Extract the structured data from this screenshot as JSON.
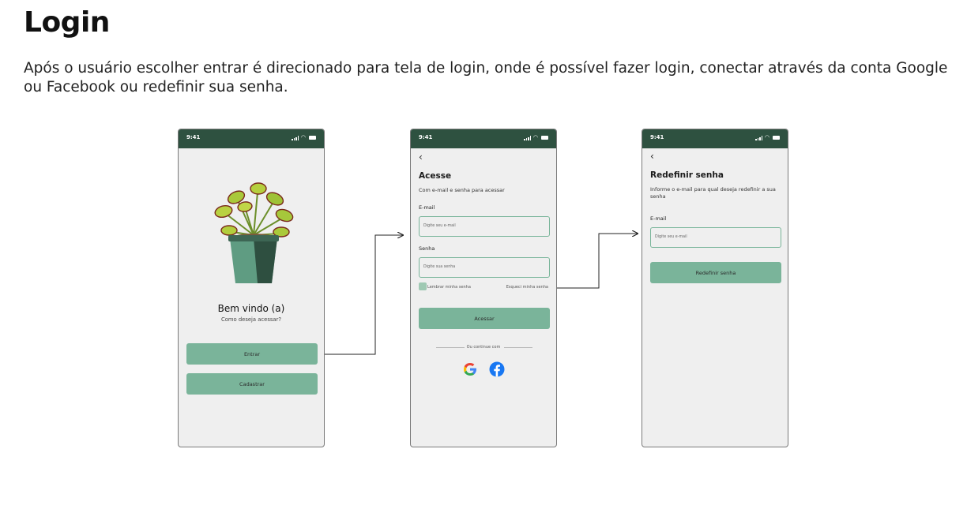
{
  "page": {
    "title": "Login",
    "description": "Após o usuário escolher entrar é direcionado para tela de login, onde é possível fazer  login, conectar através da conta Google ou Facebook ou redefinir sua senha."
  },
  "colors": {
    "status_bar": "#2e5140",
    "accent_button": "#7ab49a",
    "input_border": "#79b59a",
    "screen_bg": "#efefef"
  },
  "screens": {
    "welcome": {
      "time": "9:41",
      "illustration": "venus-flytrap-plant-pot",
      "heading": "Bem vindo (a)",
      "subheading": "Como deseja acessar?",
      "enter_button": "Entrar",
      "register_button": "Cadastrar"
    },
    "login": {
      "time": "9:41",
      "back_icon": "‹",
      "heading": "Acesse",
      "subheading": "Com e-mail e senha para acessar",
      "email_label": "E-mail",
      "email_placeholder": "Digite seu e-mail",
      "password_label": "Senha",
      "password_placeholder": "Digite sua senha",
      "remember_label": "Lembrar minha senha",
      "forgot_link": "Esqueci minha senha",
      "access_button": "Acessar",
      "divider_text": "Ou continue com",
      "social_icons": [
        "google-icon",
        "facebook-icon"
      ]
    },
    "reset": {
      "time": "9:41",
      "back_icon": "‹",
      "heading": "Redefinir senha",
      "subheading": "Informe o e-mail para qual deseja redefinir a sua senha",
      "email_label": "E-mail",
      "email_placeholder": "Digite seu e-mail",
      "reset_button": "Redefinir senha"
    }
  }
}
